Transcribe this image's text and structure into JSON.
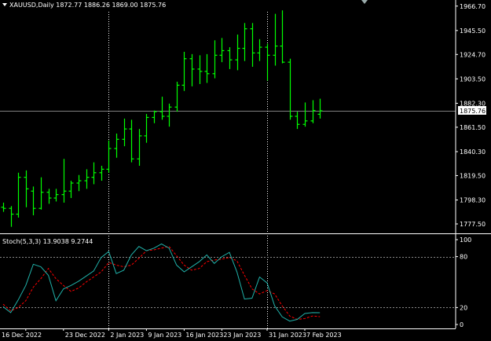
{
  "main": {
    "title": "XAUUSD,Daily  1872.77 1886.26 1869.00 1875.76",
    "current_price_label": "1875.76",
    "price_ticks": [
      "1966.70",
      "1945.50",
      "1924.70",
      "1903.50",
      "1882.30",
      "1861.50",
      "1840.30",
      "1819.50",
      "1798.30",
      "1777.50"
    ]
  },
  "stoch": {
    "title": "Stoch(5,3,3) 13.9038 9.2744",
    "ticks": [
      "100",
      "80",
      "20",
      "0"
    ]
  },
  "date_ticks": [
    "16 Dec 2022",
    "23 Dec 2022",
    "2 Jan 2023",
    "9 Jan 2023",
    "16 Jan 2023",
    "23 Jan 2023",
    "31 Jan 2023",
    "7 Feb 2023"
  ],
  "colors": {
    "background": "#000000",
    "bars": "#00ff00",
    "main_line": "#20b2aa",
    "signal_line": "#ff0000",
    "grid": "#ffffff",
    "text": "#ffffff"
  },
  "chart_data": [
    {
      "type": "ohlc",
      "title": "XAUUSD,Daily  1872.77 1886.26 1869.00 1875.76",
      "ylim": [
        1770,
        1972
      ],
      "last_price": 1875.76,
      "x": [
        "2022-12-13",
        "2022-12-14",
        "2022-12-15",
        "2022-12-16",
        "2022-12-19",
        "2022-12-20",
        "2022-12-21",
        "2022-12-22",
        "2022-12-23",
        "2022-12-26",
        "2022-12-27",
        "2022-12-28",
        "2022-12-29",
        "2022-12-30",
        "2023-01-02",
        "2023-01-03",
        "2023-01-04",
        "2023-01-05",
        "2023-01-06",
        "2023-01-09",
        "2023-01-10",
        "2023-01-11",
        "2023-01-12",
        "2023-01-13",
        "2023-01-16",
        "2023-01-17",
        "2023-01-18",
        "2023-01-19",
        "2023-01-20",
        "2023-01-23",
        "2023-01-24",
        "2023-01-25",
        "2023-01-26",
        "2023-01-27",
        "2023-01-30",
        "2023-01-31",
        "2023-02-01",
        "2023-02-02",
        "2023-02-03",
        "2023-02-06",
        "2023-02-07",
        "2023-02-08",
        "2023-02-09"
      ],
      "ohlc": [
        [
          1792,
          1796,
          1788,
          1791
        ],
        [
          1791,
          1793,
          1775,
          1786
        ],
        [
          1786,
          1822,
          1783,
          1818
        ],
        [
          1818,
          1824,
          1792,
          1808
        ],
        [
          1806,
          1810,
          1785,
          1791
        ],
        [
          1791,
          1818,
          1790,
          1805
        ],
        [
          1805,
          1808,
          1795,
          1800
        ],
        [
          1800,
          1808,
          1797,
          1803
        ],
        [
          1803,
          1834,
          1796,
          1806
        ],
        [
          1806,
          1815,
          1800,
          1813
        ],
        [
          1813,
          1820,
          1806,
          1815
        ],
        [
          1815,
          1825,
          1808,
          1818
        ],
        [
          1818,
          1831,
          1812,
          1822
        ],
        [
          1822,
          1828,
          1815,
          1825
        ],
        [
          1825,
          1850,
          1822,
          1843
        ],
        [
          1843,
          1856,
          1835,
          1851
        ],
        [
          1851,
          1869,
          1845,
          1860
        ],
        [
          1860,
          1868,
          1831,
          1834
        ],
        [
          1834,
          1860,
          1828,
          1854
        ],
        [
          1854,
          1873,
          1848,
          1870
        ],
        [
          1870,
          1876,
          1865,
          1875
        ],
        [
          1875,
          1888,
          1868,
          1871
        ],
        [
          1871,
          1882,
          1862,
          1879
        ],
        [
          1879,
          1901,
          1875,
          1898
        ],
        [
          1898,
          1927,
          1893,
          1921
        ],
        [
          1921,
          1925,
          1897,
          1912
        ],
        [
          1912,
          1924,
          1899,
          1910
        ],
        [
          1910,
          1925,
          1900,
          1908
        ],
        [
          1908,
          1937,
          1904,
          1924
        ],
        [
          1924,
          1939,
          1918,
          1928
        ],
        [
          1928,
          1931,
          1912,
          1920
        ],
        [
          1920,
          1942,
          1911,
          1930
        ],
        [
          1930,
          1952,
          1919,
          1947
        ],
        [
          1947,
          1952,
          1914,
          1926
        ],
        [
          1926,
          1938,
          1919,
          1931
        ],
        [
          1931,
          1934,
          1902,
          1924
        ],
        [
          1924,
          1960,
          1915,
          1932
        ],
        [
          1932,
          1963,
          1917,
          1918
        ],
        [
          1918,
          1921,
          1868,
          1871
        ],
        [
          1871,
          1875,
          1860,
          1864
        ],
        [
          1864,
          1883,
          1862,
          1867
        ],
        [
          1867,
          1885,
          1865,
          1876
        ],
        [
          1872.77,
          1886.26,
          1869.0,
          1875.76
        ]
      ]
    },
    {
      "type": "line",
      "title": "Stoch(5,3,3) 13.9038 9.2744",
      "ylim": [
        0,
        100
      ],
      "levels": [
        80,
        20
      ],
      "series": [
        {
          "name": "main",
          "values": [
            21,
            14,
            29,
            46,
            71,
            68,
            58,
            28,
            42,
            46,
            51,
            57,
            63,
            79,
            86,
            60,
            64,
            82,
            92,
            87,
            90,
            95,
            90,
            70,
            62,
            68,
            74,
            82,
            72,
            80,
            85,
            62,
            30,
            31,
            56,
            49,
            22,
            9,
            4,
            6,
            13,
            14,
            13.9038
          ]
        },
        {
          "name": "signal",
          "values": [
            24,
            16,
            20,
            28,
            44,
            54,
            66,
            54,
            46,
            39,
            43,
            50,
            56,
            62,
            73,
            70,
            68,
            70,
            78,
            87,
            88,
            90,
            92,
            81,
            70,
            64,
            66,
            74,
            76,
            77,
            79,
            75,
            58,
            42,
            36,
            40,
            36,
            22,
            10,
            6,
            7,
            10,
            9.2744
          ]
        }
      ]
    }
  ]
}
